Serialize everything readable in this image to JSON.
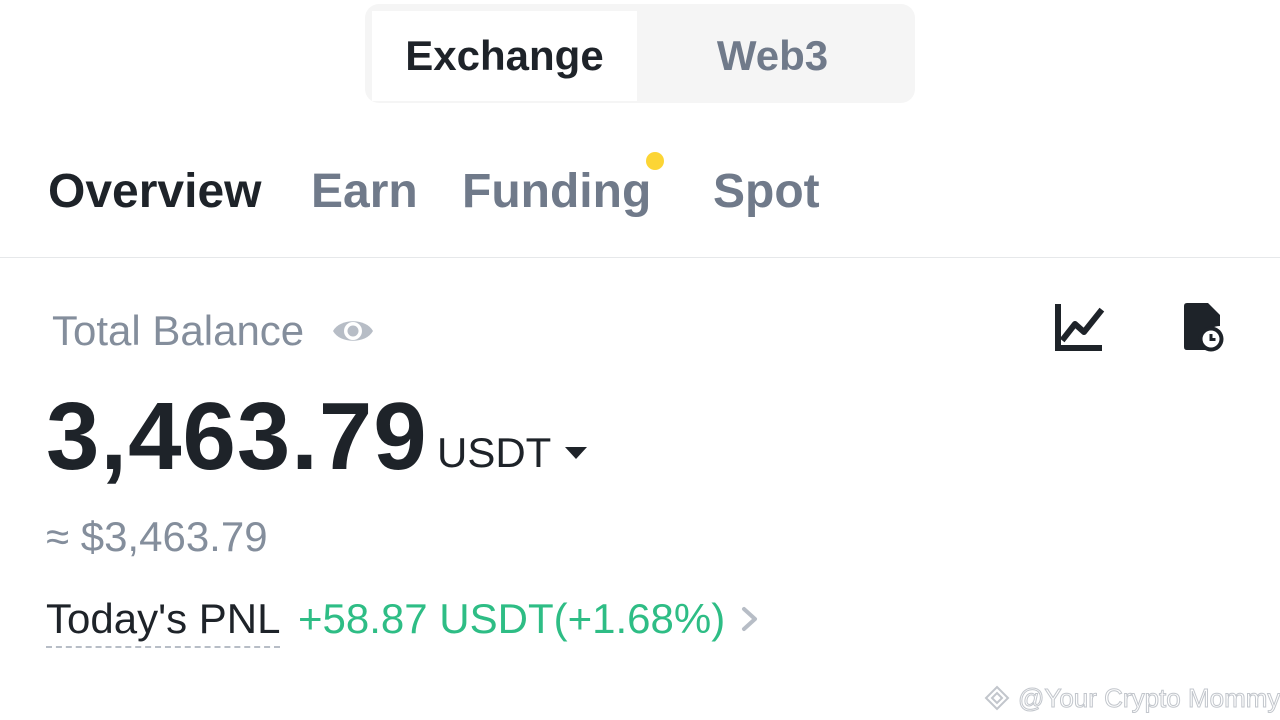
{
  "mode_toggle": {
    "options": [
      {
        "label": "Exchange",
        "active": true
      },
      {
        "label": "Web3",
        "active": false
      }
    ]
  },
  "tabs": [
    {
      "label": "Overview",
      "active": true
    },
    {
      "label": "Earn",
      "active": false
    },
    {
      "label": "Funding",
      "active": false,
      "has_notification_dot": true
    },
    {
      "label": "Spot",
      "active": false
    }
  ],
  "balance": {
    "label": "Total Balance",
    "value": "3,463.79",
    "currency": "USDT",
    "approx_fiat": "≈ $3,463.79",
    "icons": [
      "eye-icon",
      "chart-icon",
      "history-icon"
    ]
  },
  "pnl": {
    "label": "Today's PNL",
    "value": "+58.87 USDT(+1.68%)"
  },
  "watermark": {
    "text": "@Your Crypto Mommy"
  },
  "colors": {
    "text_primary": "#1e2329",
    "text_secondary": "#707a8a",
    "text_muted": "#848e9c",
    "positive": "#2ebd85",
    "notification_dot": "#fcd535",
    "segment_bg": "#f5f5f5"
  }
}
